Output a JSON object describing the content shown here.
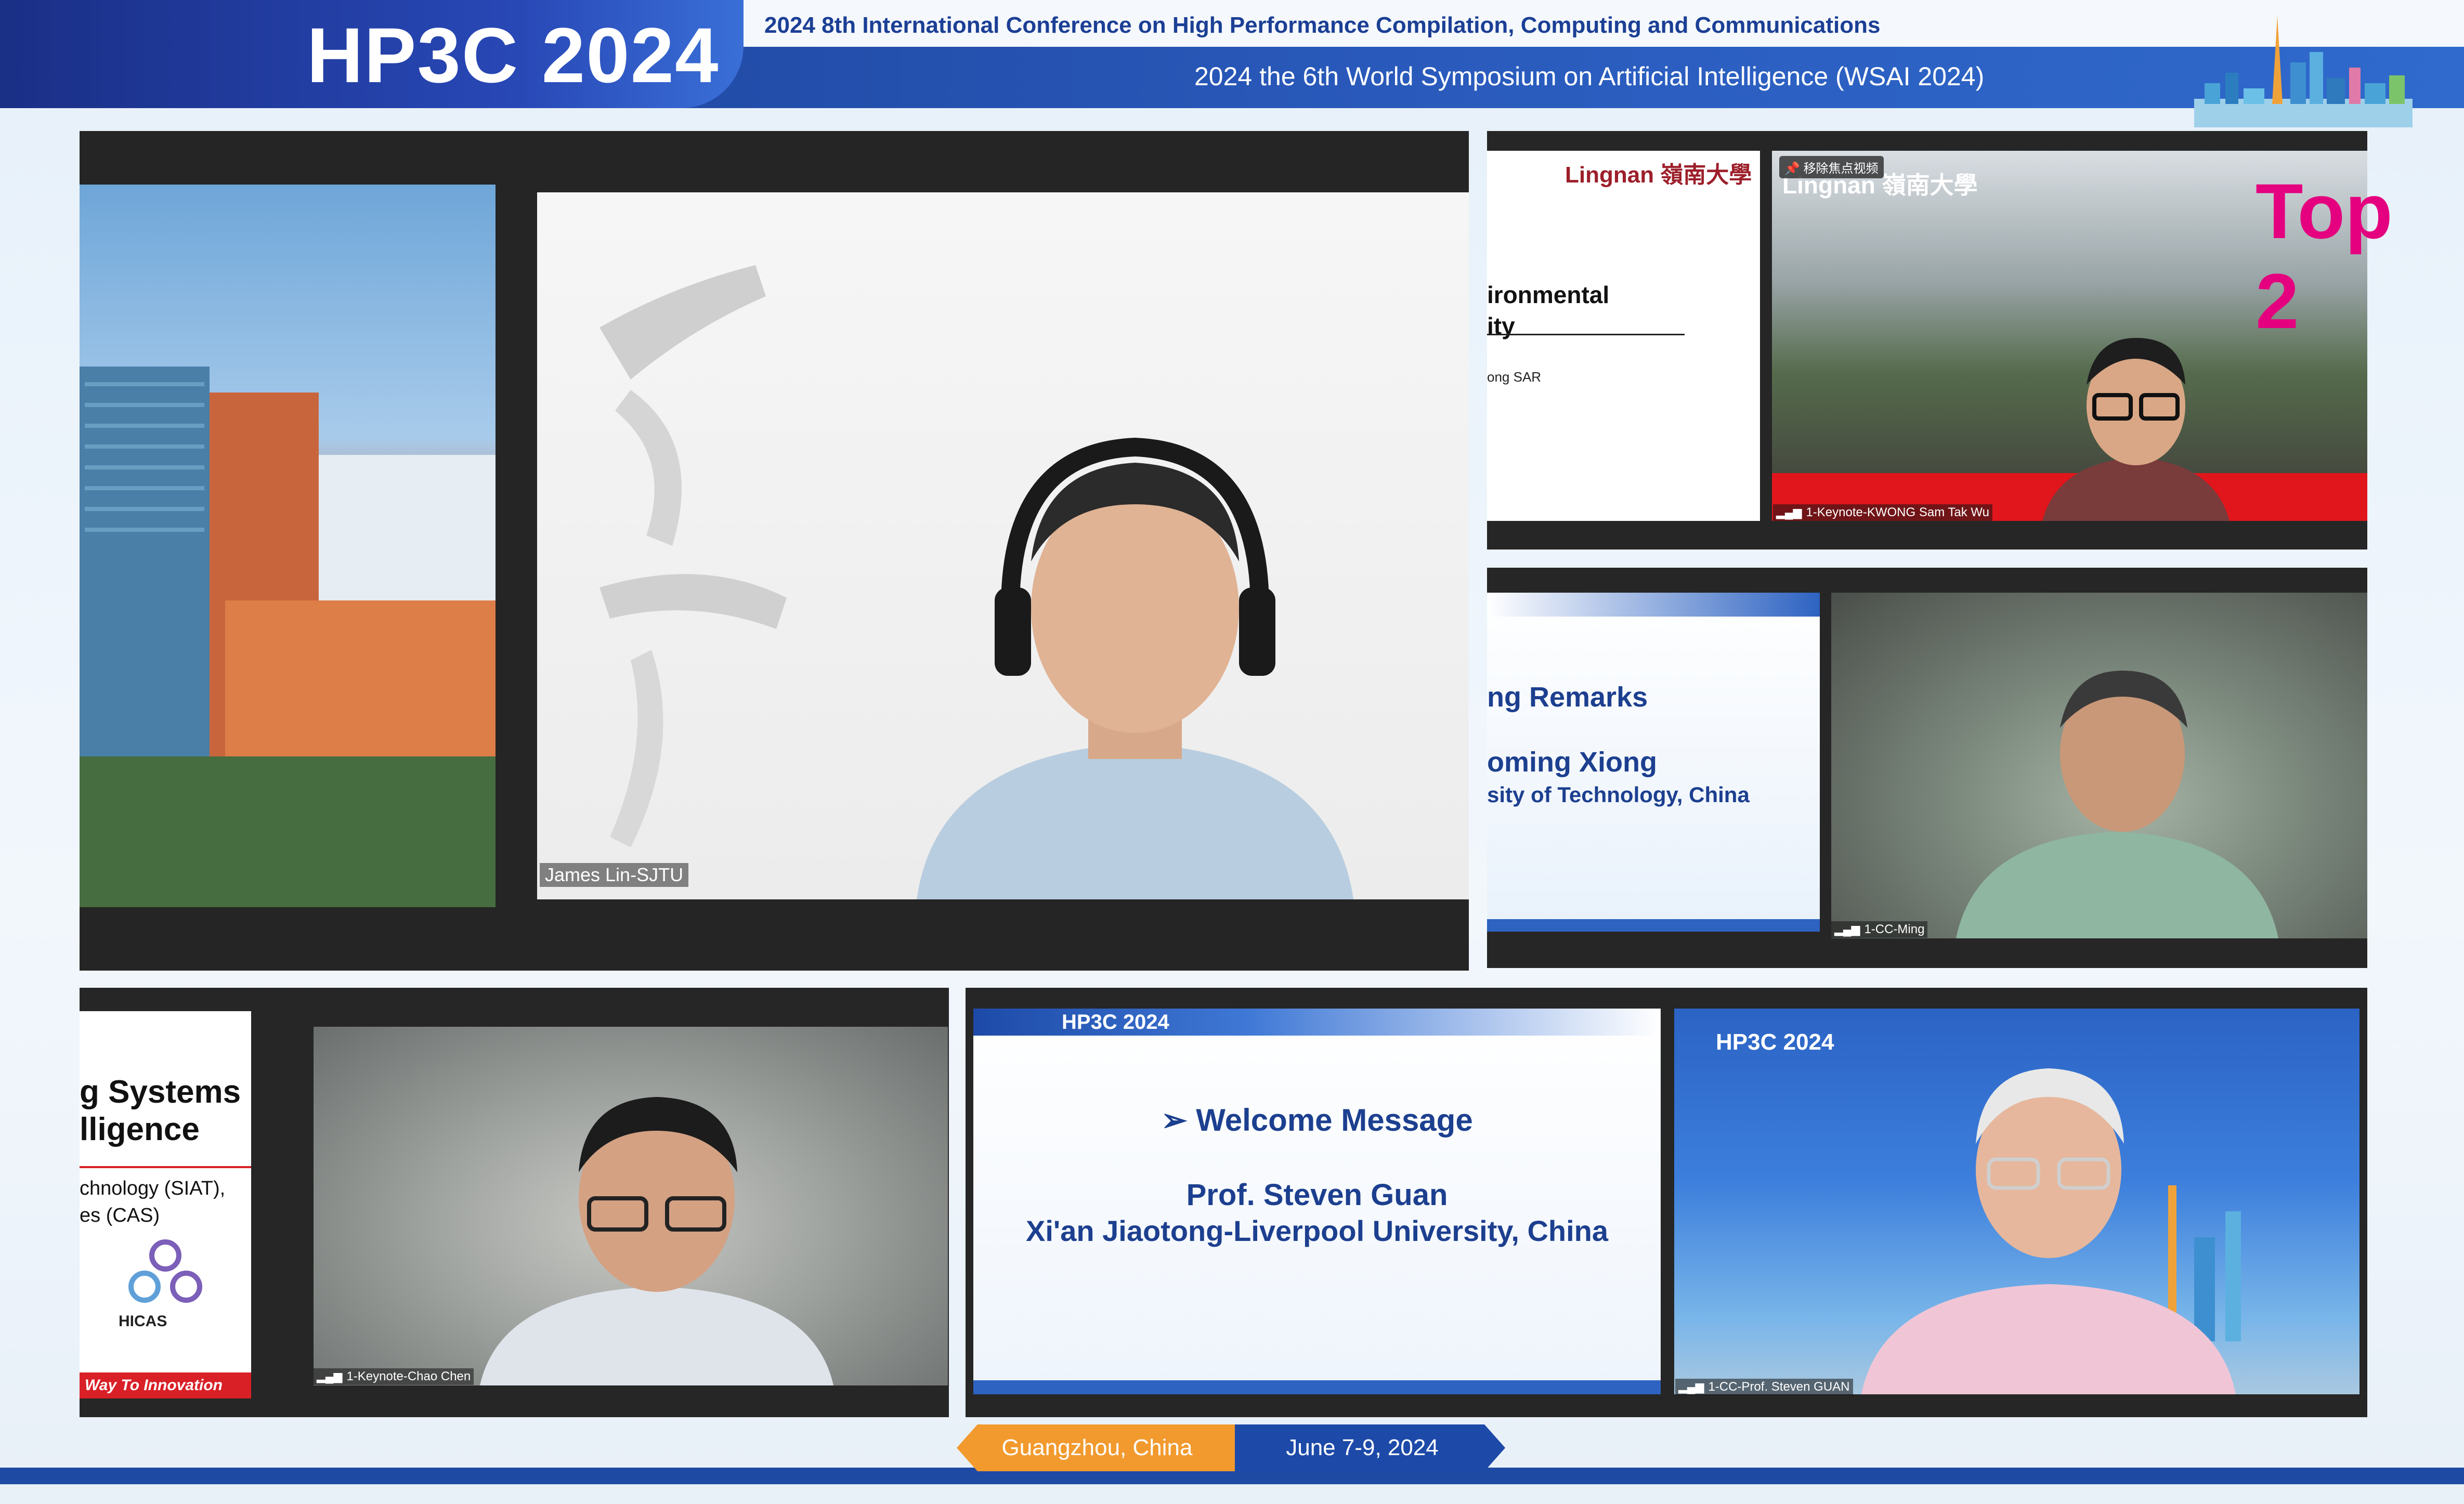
{
  "header": {
    "logo": "HP3C 2024",
    "line1": "2024 8th International Conference on High Performance Compilation, Computing and Communications",
    "line2": "2024 the 6th World Symposium on Artificial Intelligence (WSAI 2024)"
  },
  "participants": [
    {
      "name": "James Lin-SJTU",
      "role": "main"
    },
    {
      "name": "1-Keynote-KWONG Sam Tak Wu"
    },
    {
      "name": "1-CC-Ming"
    },
    {
      "name": "1-Keynote-Chao Chen"
    },
    {
      "name": "1-CC-Prof. Steven GUAN"
    }
  ],
  "tiles": {
    "top_right": {
      "pin_label": "移除焦点视频",
      "slide_brand": "Lingnan 嶺南大學",
      "slide_line1": "ironmental",
      "slide_line2": "ity",
      "slide_line3": "ong SAR",
      "video_brand": "Lingnan 嶺南大學",
      "banner": "Top 2"
    },
    "mid_right": {
      "line1": "ng Remarks",
      "line2": "oming Xiong",
      "line3": "sity of Technology, China"
    },
    "bottom_left": {
      "line1": "g Systems",
      "line2": "lligence",
      "line3": "chnology (SIAT),",
      "line4": "es (CAS)",
      "brand": "HICAS",
      "tagline": "Way To Innovation"
    },
    "bottom_right": {
      "slide_logo": "HP3C 2024",
      "heading": "➢ Welcome Message",
      "speaker": "Prof. Steven Guan",
      "affiliation": "Xi'an Jiaotong-Liverpool University, China",
      "video_logo": "HP3C 2024"
    }
  },
  "footer": {
    "location": "Guangzhou, China",
    "date": "June 7-9, 2024"
  },
  "colors": {
    "brand_blue": "#1d4aa8",
    "accent_orange": "#f29a2e",
    "lingnan_red": "#e0161c"
  }
}
